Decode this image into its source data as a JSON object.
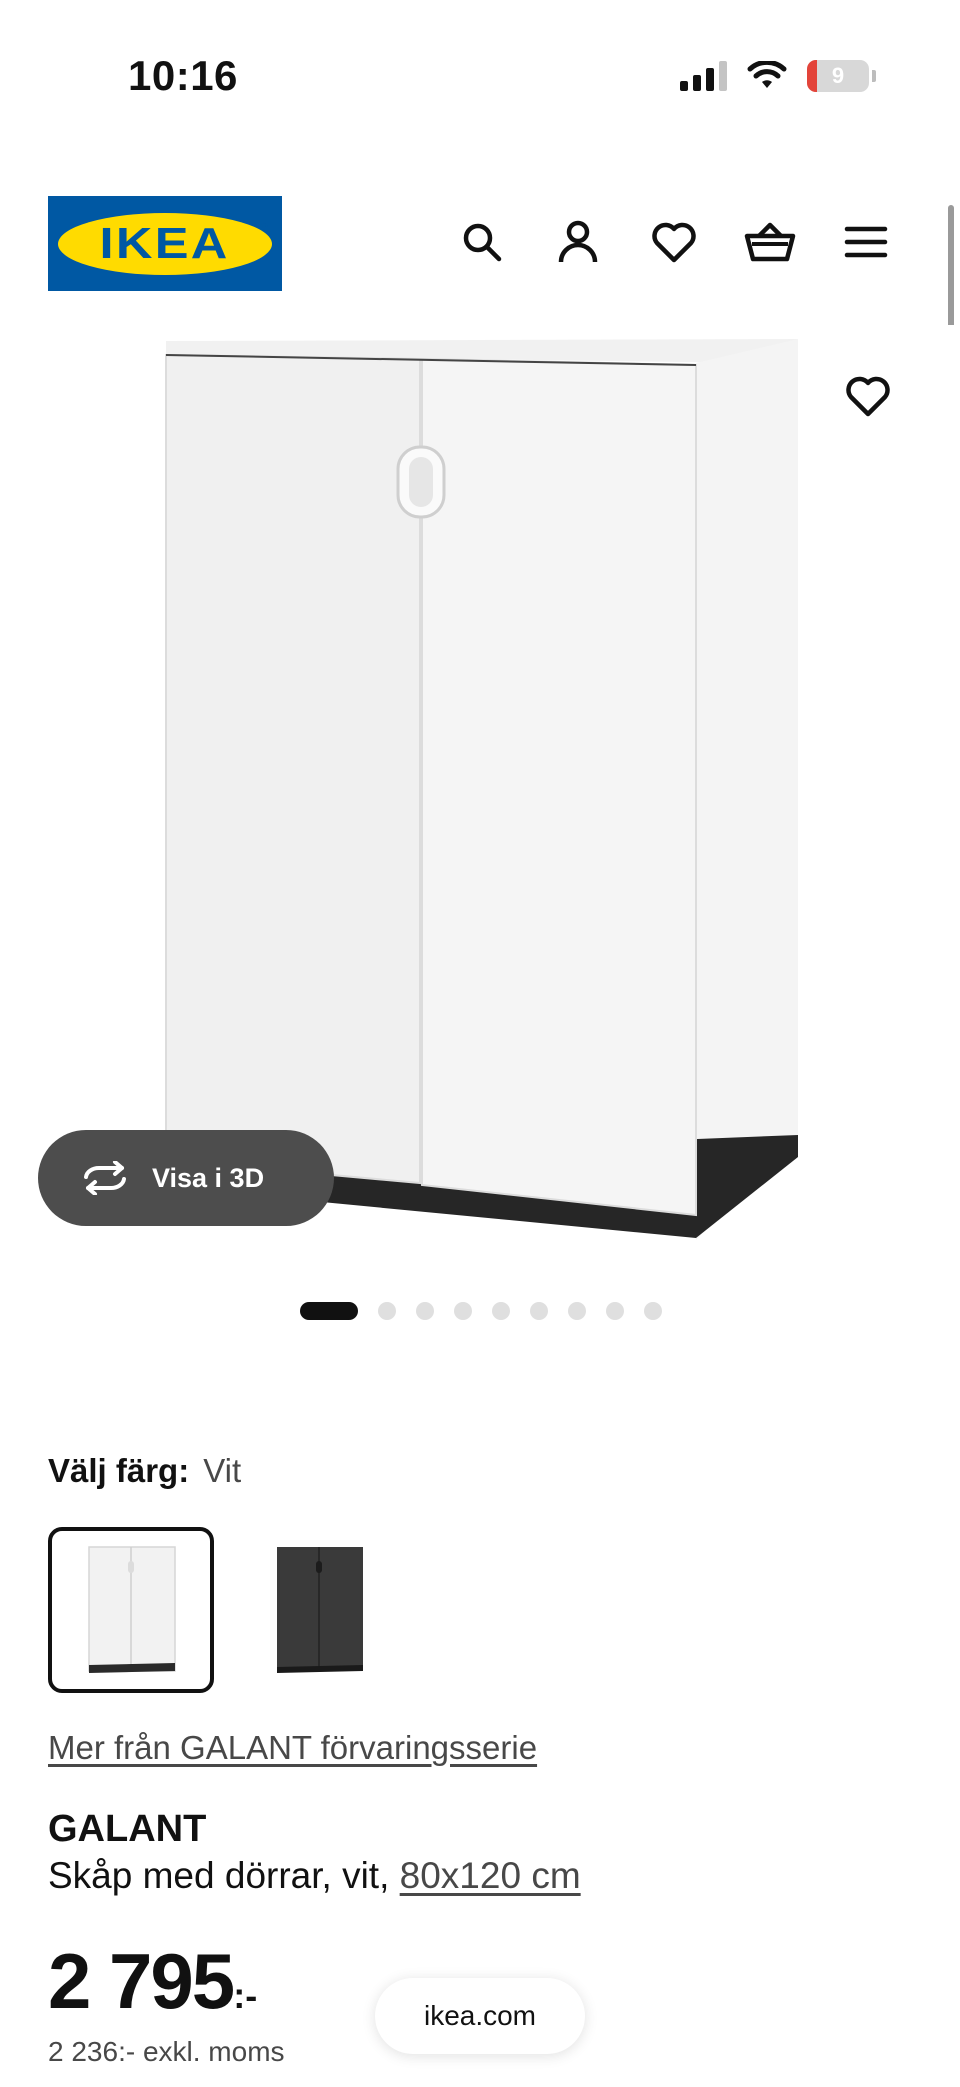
{
  "status_bar": {
    "time": "10:16",
    "battery_level": "9",
    "icons": [
      "cellular-signal-icon",
      "wifi-icon",
      "battery-icon"
    ]
  },
  "header": {
    "logo_text": "IKEA",
    "icons": [
      "search-icon",
      "user-icon",
      "heart-icon",
      "basket-icon",
      "menu-icon"
    ],
    "brand_colors": {
      "blue": "#0058a3",
      "yellow": "#ffdb00"
    }
  },
  "gallery": {
    "view_3d_label": "Visa i 3D",
    "image_count": 9,
    "active_index": 0
  },
  "color_selector": {
    "label": "Välj färg:",
    "selected_value": "Vit",
    "options": [
      {
        "name": "white",
        "selected": true
      },
      {
        "name": "black-brown",
        "selected": false
      }
    ]
  },
  "product": {
    "series_link": "Mer från GALANT förvaringsserie",
    "name": "GALANT",
    "description": "Skåp med dörrar, vit,",
    "size_link": "80x120 cm",
    "price": "2 795",
    "price_suffix": ":-",
    "price_excl_vat": "2 236:- exkl. moms"
  },
  "browser": {
    "url": "ikea.com"
  }
}
